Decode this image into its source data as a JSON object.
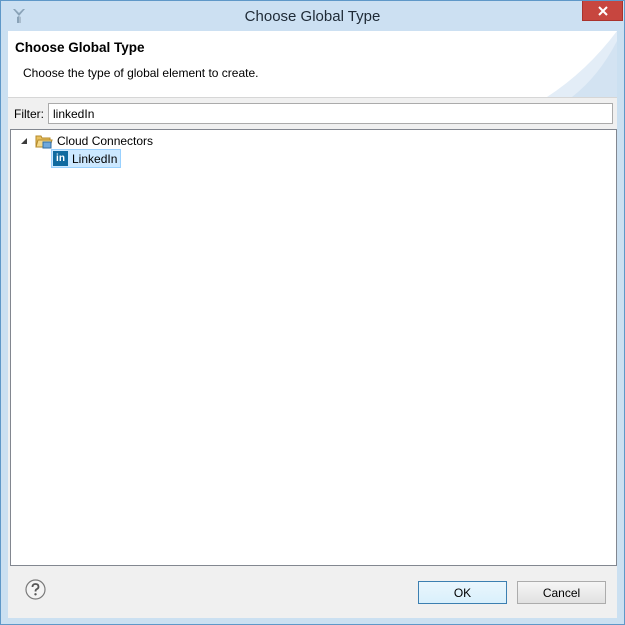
{
  "window": {
    "title": "Choose Global Type"
  },
  "banner": {
    "title": "Choose Global Type",
    "description": "Choose the type of global element to create."
  },
  "filter": {
    "label": "Filter:",
    "value": "linkedIn"
  },
  "tree": {
    "category": {
      "label": "Cloud Connectors",
      "expanded": true,
      "icon": "folder-icon"
    },
    "items": [
      {
        "label": "LinkedIn",
        "selected": true,
        "icon": "linkedin-icon",
        "icon_text": "in"
      }
    ]
  },
  "buttons": {
    "ok": "OK",
    "cancel": "Cancel"
  },
  "colors": {
    "title_bar": "#cce0f2",
    "close_button": "#c7463f",
    "selection": "#cce8ff",
    "linkedin": "#0f6aa0"
  }
}
